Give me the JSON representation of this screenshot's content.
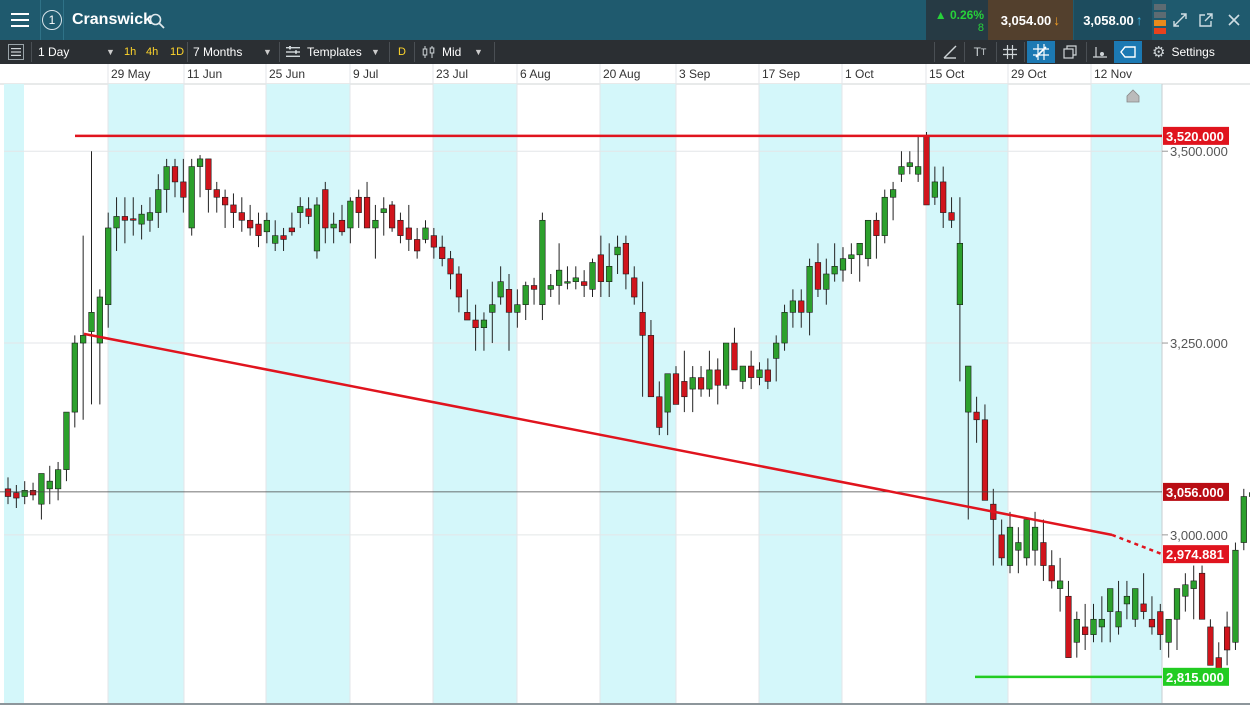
{
  "app": {
    "instrument": "Cranswick",
    "alert_count": "1",
    "change_pct": "0.26%",
    "change_pts": "8",
    "sell_price": "3,054.00",
    "buy_price": "3,058.00"
  },
  "toolbar": {
    "interval": "1 Day",
    "quick_intervals": [
      "1h",
      "4h",
      "1D"
    ],
    "quick_d": "D",
    "range": "7 Months",
    "templates": "Templates",
    "price_type": "Mid",
    "settings": "Settings"
  },
  "colors": {
    "titlebar": "#1f5a6e",
    "toolbar": "#2b2f33",
    "up": "#2ca02c",
    "down": "#d0141c",
    "trendline": "#e0141e",
    "support": "#22cc22",
    "band": "#d4f7fa"
  },
  "chart_data": {
    "type": "candlestick",
    "x_tick_labels": [
      "29 May",
      "11 Jun",
      "25 Jun",
      "9 Jul",
      "23 Jul",
      "6 Aug",
      "20 Aug",
      "3 Sep",
      "17 Sep",
      "1 Oct",
      "15 Oct",
      "29 Oct",
      "12 Nov"
    ],
    "y_tick_labels": [
      "3,500.000",
      "3,250.000",
      "3,000.000"
    ],
    "y_range": [
      2790,
      3585
    ],
    "current_price_label": "3,056.000",
    "current_price": 3056,
    "horizontal_lines": [
      {
        "label": "3,520.000",
        "value": 3520,
        "color": "red"
      },
      {
        "label": "2,815.000",
        "value": 2815,
        "color": "green"
      }
    ],
    "trendline": {
      "start_date": "18 May",
      "start_value": 3262,
      "end_date": "13 Nov",
      "end_value": 3000,
      "projection_label": "2,974.881",
      "projection_value": 2974.881
    },
    "ohlc": [
      [
        3060,
        3075,
        3040,
        3050
      ],
      [
        3055,
        3065,
        3035,
        3048
      ],
      [
        3050,
        3070,
        3040,
        3058
      ],
      [
        3058,
        3068,
        3045,
        3052
      ],
      [
        3040,
        3070,
        3020,
        3080
      ],
      [
        3060,
        3090,
        3040,
        3070
      ],
      [
        3060,
        3095,
        3045,
        3085
      ],
      [
        3085,
        3120,
        3070,
        3160
      ],
      [
        3160,
        3260,
        3140,
        3250
      ],
      [
        3250,
        3390,
        3150,
        3260
      ],
      [
        3265,
        3500,
        3170,
        3290
      ],
      [
        3250,
        3320,
        3170,
        3310
      ],
      [
        3300,
        3420,
        3270,
        3400
      ],
      [
        3400,
        3440,
        3370,
        3415
      ],
      [
        3415,
        3440,
        3380,
        3410
      ],
      [
        3412,
        3440,
        3390,
        3410
      ],
      [
        3405,
        3430,
        3385,
        3418
      ],
      [
        3410,
        3440,
        3395,
        3420
      ],
      [
        3420,
        3470,
        3400,
        3450
      ],
      [
        3450,
        3490,
        3420,
        3480
      ],
      [
        3480,
        3490,
        3440,
        3460
      ],
      [
        3460,
        3490,
        3420,
        3440
      ],
      [
        3400,
        3490,
        3390,
        3480
      ],
      [
        3480,
        3495,
        3440,
        3490
      ],
      [
        3490,
        3490,
        3420,
        3450
      ],
      [
        3450,
        3460,
        3420,
        3440
      ],
      [
        3440,
        3450,
        3400,
        3430
      ],
      [
        3430,
        3445,
        3400,
        3420
      ],
      [
        3420,
        3440,
        3395,
        3410
      ],
      [
        3410,
        3430,
        3390,
        3400
      ],
      [
        3405,
        3420,
        3375,
        3390
      ],
      [
        3395,
        3420,
        3380,
        3410
      ],
      [
        3380,
        3410,
        3370,
        3390
      ],
      [
        3390,
        3400,
        3370,
        3385
      ],
      [
        3400,
        3420,
        3390,
        3395
      ],
      [
        3420,
        3440,
        3400,
        3428
      ],
      [
        3425,
        3440,
        3405,
        3415
      ],
      [
        3370,
        3440,
        3360,
        3430
      ],
      [
        3450,
        3460,
        3380,
        3400
      ],
      [
        3400,
        3420,
        3380,
        3405
      ],
      [
        3410,
        3430,
        3390,
        3395
      ],
      [
        3400,
        3440,
        3380,
        3435
      ],
      [
        3440,
        3450,
        3400,
        3420
      ],
      [
        3440,
        3460,
        3410,
        3400
      ],
      [
        3400,
        3430,
        3360,
        3410
      ],
      [
        3420,
        3440,
        3390,
        3425
      ],
      [
        3430,
        3435,
        3395,
        3400
      ],
      [
        3410,
        3420,
        3380,
        3390
      ],
      [
        3400,
        3430,
        3370,
        3385
      ],
      [
        3385,
        3400,
        3360,
        3370
      ],
      [
        3385,
        3410,
        3380,
        3400
      ],
      [
        3390,
        3400,
        3360,
        3375
      ],
      [
        3375,
        3390,
        3350,
        3360
      ],
      [
        3360,
        3370,
        3320,
        3340
      ],
      [
        3340,
        3350,
        3290,
        3310
      ],
      [
        3290,
        3320,
        3280,
        3280
      ],
      [
        3280,
        3300,
        3240,
        3270
      ],
      [
        3270,
        3290,
        3240,
        3280
      ],
      [
        3290,
        3330,
        3250,
        3300
      ],
      [
        3310,
        3350,
        3300,
        3330
      ],
      [
        3320,
        3340,
        3240,
        3290
      ],
      [
        3290,
        3320,
        3270,
        3300
      ],
      [
        3300,
        3330,
        3280,
        3325
      ],
      [
        3325,
        3335,
        3300,
        3320
      ],
      [
        3300,
        3420,
        3280,
        3410
      ],
      [
        3320,
        3340,
        3310,
        3325
      ],
      [
        3325,
        3380,
        3300,
        3345
      ],
      [
        3330,
        3350,
        3320,
        3330
      ],
      [
        3330,
        3350,
        3320,
        3335
      ],
      [
        3330,
        3345,
        3310,
        3325
      ],
      [
        3320,
        3360,
        3310,
        3355
      ],
      [
        3365,
        3390,
        3310,
        3330
      ],
      [
        3330,
        3380,
        3310,
        3350
      ],
      [
        3365,
        3390,
        3340,
        3375
      ],
      [
        3380,
        3390,
        3320,
        3340
      ],
      [
        3335,
        3350,
        3300,
        3310
      ],
      [
        3290,
        3330,
        3180,
        3260
      ],
      [
        3260,
        3280,
        3180,
        3180
      ],
      [
        3180,
        3200,
        3130,
        3140
      ],
      [
        3160,
        3180,
        3130,
        3210
      ],
      [
        3210,
        3220,
        3180,
        3170
      ],
      [
        3200,
        3240,
        3160,
        3180
      ],
      [
        3190,
        3220,
        3160,
        3205
      ],
      [
        3205,
        3220,
        3180,
        3190
      ],
      [
        3190,
        3240,
        3180,
        3215
      ],
      [
        3215,
        3230,
        3170,
        3195
      ],
      [
        3195,
        3240,
        3190,
        3250
      ],
      [
        3250,
        3270,
        3220,
        3215
      ],
      [
        3200,
        3210,
        3190,
        3220
      ],
      [
        3220,
        3240,
        3190,
        3205
      ],
      [
        3205,
        3225,
        3195,
        3215
      ],
      [
        3215,
        3230,
        3190,
        3200
      ],
      [
        3230,
        3260,
        3200,
        3250
      ],
      [
        3250,
        3300,
        3240,
        3290
      ],
      [
        3290,
        3320,
        3270,
        3305
      ],
      [
        3305,
        3320,
        3270,
        3290
      ],
      [
        3290,
        3360,
        3260,
        3350
      ],
      [
        3355,
        3380,
        3310,
        3320
      ],
      [
        3320,
        3360,
        3300,
        3340
      ],
      [
        3340,
        3380,
        3330,
        3350
      ],
      [
        3345,
        3375,
        3330,
        3360
      ],
      [
        3360,
        3380,
        3340,
        3365
      ],
      [
        3365,
        3380,
        3330,
        3380
      ],
      [
        3360,
        3410,
        3350,
        3410
      ],
      [
        3410,
        3420,
        3360,
        3390
      ],
      [
        3390,
        3450,
        3380,
        3440
      ],
      [
        3440,
        3460,
        3410,
        3450
      ],
      [
        3470,
        3500,
        3460,
        3480
      ],
      [
        3480,
        3500,
        3470,
        3485
      ],
      [
        3470,
        3520,
        3460,
        3480
      ],
      [
        3520,
        3525,
        3450,
        3430
      ],
      [
        3440,
        3480,
        3430,
        3460
      ],
      [
        3460,
        3480,
        3400,
        3420
      ],
      [
        3420,
        3440,
        3400,
        3410
      ],
      [
        3300,
        3440,
        3200,
        3380
      ],
      [
        3160,
        3200,
        3020,
        3220
      ],
      [
        3160,
        3180,
        3120,
        3150
      ],
      [
        3150,
        3170,
        3110,
        3045
      ],
      [
        3040,
        3060,
        2960,
        3020
      ],
      [
        3000,
        3020,
        2960,
        2970
      ],
      [
        2960,
        3030,
        2950,
        3010
      ],
      [
        2980,
        3010,
        2950,
        2990
      ],
      [
        2970,
        3020,
        2960,
        3020
      ],
      [
        2980,
        3030,
        2960,
        3010
      ],
      [
        2990,
        3020,
        2940,
        2960
      ],
      [
        2960,
        2980,
        2930,
        2940
      ],
      [
        2930,
        2970,
        2900,
        2940
      ],
      [
        2920,
        2940,
        2840,
        2840
      ],
      [
        2860,
        2900,
        2840,
        2890
      ],
      [
        2880,
        2910,
        2850,
        2870
      ],
      [
        2870,
        2910,
        2860,
        2890
      ],
      [
        2880,
        2920,
        2860,
        2890
      ],
      [
        2900,
        2920,
        2860,
        2930
      ],
      [
        2880,
        2940,
        2870,
        2900
      ],
      [
        2910,
        2940,
        2890,
        2920
      ],
      [
        2890,
        2920,
        2880,
        2930
      ],
      [
        2910,
        2950,
        2890,
        2900
      ],
      [
        2890,
        2920,
        2870,
        2880
      ],
      [
        2900,
        2910,
        2850,
        2870
      ],
      [
        2860,
        2890,
        2840,
        2890
      ],
      [
        2890,
        2930,
        2850,
        2930
      ],
      [
        2920,
        2950,
        2900,
        2935
      ],
      [
        2930,
        2960,
        2890,
        2940
      ],
      [
        2950,
        2960,
        2920,
        2890
      ],
      [
        2880,
        2890,
        2830,
        2830
      ],
      [
        2840,
        2860,
        2820,
        2820
      ],
      [
        2880,
        2900,
        2830,
        2850
      ],
      [
        2860,
        2990,
        2850,
        2980
      ],
      [
        2990,
        3060,
        2980,
        3050
      ],
      [
        3050,
        3065,
        3040,
        3055
      ]
    ]
  }
}
